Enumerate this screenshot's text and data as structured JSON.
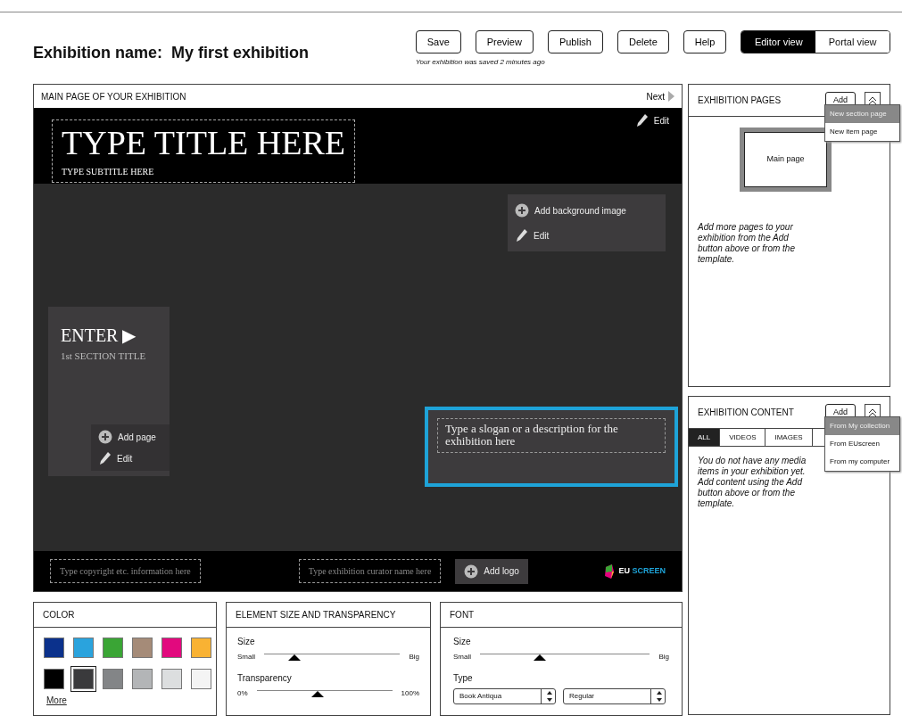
{
  "header": {
    "label": "Exhibition name:",
    "name": "My first exhibition"
  },
  "toolbar": {
    "buttons": [
      "Save",
      "Preview",
      "Publish",
      "Delete",
      "Help"
    ],
    "save_note": "Your exhibition was saved 2 minutes ago"
  },
  "views": [
    {
      "label": "Editor view",
      "selected": true
    },
    {
      "label": "Portal view",
      "selected": false
    }
  ],
  "main_page": {
    "title": "MAIN PAGE OF YOUR EXHIBITION",
    "next": "Next",
    "header_edit": "Edit",
    "title_placeholder": "TYPE TITLE HERE",
    "subtitle_placeholder": "TYPE SUBTITLE HERE",
    "background_actions": [
      {
        "kind": "add",
        "label": "Add background image"
      },
      {
        "kind": "edit",
        "label": "Edit"
      }
    ],
    "section": {
      "enter": "ENTER ▶",
      "title": "1st SECTION TITLE",
      "actions": [
        {
          "kind": "add",
          "label": "Add page"
        },
        {
          "kind": "edit",
          "label": "Edit"
        }
      ]
    },
    "slogan": "Type a slogan or a description for the exhibition here",
    "footer": {
      "copyright_placeholder": "Type copyright etc. information here",
      "curator_placeholder": "Type exhibition curator name here",
      "add_logo": "Add logo",
      "logo": [
        "EU",
        "SCREEN"
      ]
    }
  },
  "pages_panel": {
    "title": "EXHIBITION PAGES",
    "add": "Add",
    "menu": [
      {
        "label": "New section page",
        "selected": true
      },
      {
        "label": "New item page",
        "selected": false
      }
    ],
    "thumbnail": "Main page",
    "hint": "Add more pages to your exhibition from the Add button above or from the template."
  },
  "content_panel": {
    "title": "EXHIBITION CONTENT",
    "add": "Add",
    "tabs": [
      {
        "label": "ALL",
        "selected": true
      },
      {
        "label": "VIDEOS",
        "selected": false
      },
      {
        "label": "IMAGES",
        "selected": false
      }
    ],
    "menu": [
      {
        "label": "From My collection",
        "selected": true
      },
      {
        "label": "From EUscreen",
        "selected": false
      },
      {
        "label": "From my computer",
        "selected": false
      }
    ],
    "hint": "You do not have any media items in your exhibition yet. Add content using the Add button above or from the template."
  },
  "color_panel": {
    "title": "COLOR",
    "swatches": [
      {
        "color": "#0b318c",
        "selected": false
      },
      {
        "color": "#2aa3dd",
        "selected": false
      },
      {
        "color": "#3aa535",
        "selected": false
      },
      {
        "color": "#a58b78",
        "selected": false
      },
      {
        "color": "#e2097e",
        "selected": false
      },
      {
        "color": "#f9b233",
        "selected": false
      },
      {
        "color": "#000000",
        "selected": false
      },
      {
        "color": "#3a3a3c",
        "selected": true
      },
      {
        "color": "#838587",
        "selected": false
      },
      {
        "color": "#b3b5b7",
        "selected": false
      },
      {
        "color": "#dcdedf",
        "selected": false
      },
      {
        "color": "#f4f4f4",
        "selected": false
      }
    ],
    "more": "More"
  },
  "size_panel": {
    "title": "ELEMENT SIZE AND TRANSPARENCY",
    "sliders": [
      {
        "label": "Size",
        "min": "Small",
        "max": "Big",
        "level": 0.22
      },
      {
        "label": "Transparency",
        "min": "0%",
        "max": "100%",
        "level": 0.45
      }
    ]
  },
  "font_panel": {
    "title": "FONT",
    "size": {
      "label": "Size",
      "min": "Small",
      "max": "Big",
      "level": 0.35
    },
    "type_label": "Type",
    "selects": [
      "Book Antiqua",
      "Regular"
    ]
  }
}
